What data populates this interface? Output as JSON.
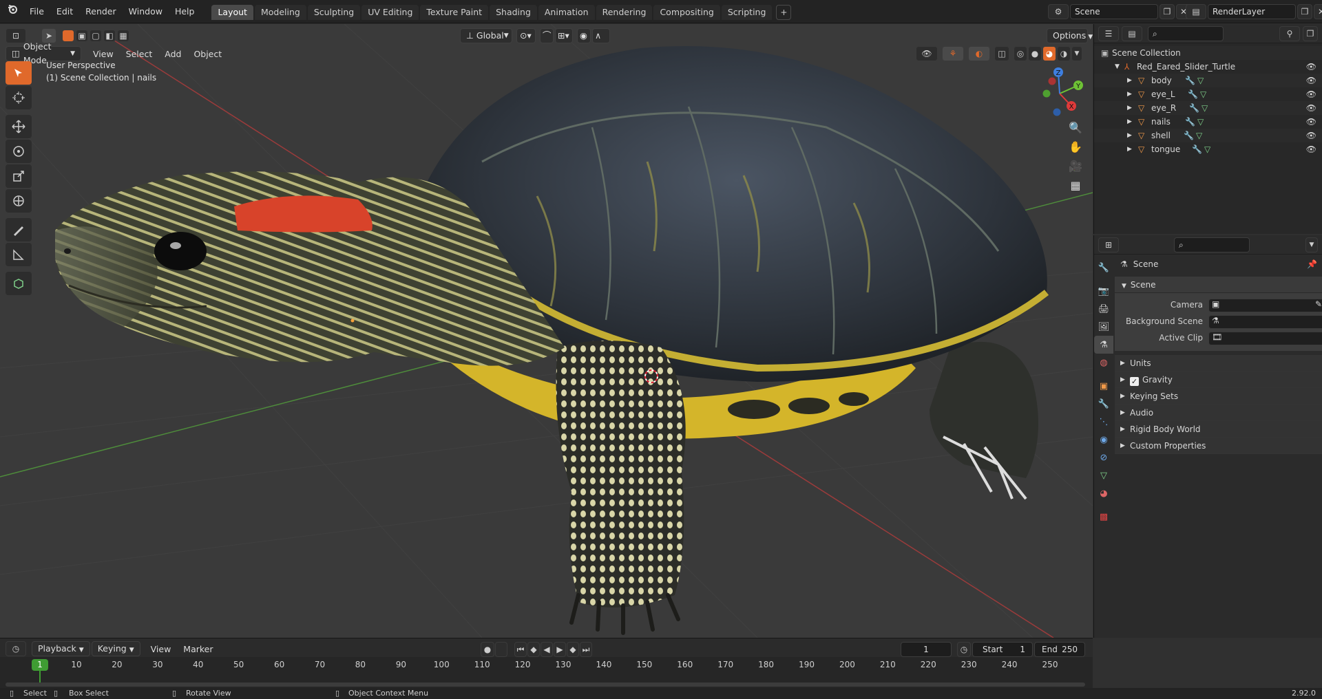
{
  "menubar": {
    "items": [
      "File",
      "Edit",
      "Render",
      "Window",
      "Help"
    ],
    "workspaces": [
      "Layout",
      "Modeling",
      "Sculpting",
      "UV Editing",
      "Texture Paint",
      "Shading",
      "Animation",
      "Rendering",
      "Compositing",
      "Scripting"
    ],
    "active_workspace": "Layout",
    "add_tab": "+",
    "scene_field": "Scene",
    "render_layer_field": "RenderLayer"
  },
  "viewport": {
    "mode": "Object Mode",
    "menus": [
      "View",
      "Select",
      "Add",
      "Object"
    ],
    "transform_orientation": "Global",
    "options_label": "Options",
    "perspective_label": "User Perspective",
    "collection_label": "(1) Scene Collection | nails",
    "gizmo_axes": {
      "x": "X",
      "y": "Y",
      "z": "Z"
    }
  },
  "outliner": {
    "root": "Scene Collection",
    "collection": "Red_Eared_Slider_Turtle",
    "objects": [
      "body",
      "eye_L",
      "eye_R",
      "nails",
      "shell",
      "tongue"
    ]
  },
  "properties": {
    "header": "Scene",
    "panel": "Scene",
    "fields": [
      {
        "label": "Camera"
      },
      {
        "label": "Background Scene"
      },
      {
        "label": "Active Clip"
      }
    ],
    "subpanels": [
      "Units",
      "Gravity",
      "Keying Sets",
      "Audio",
      "Rigid Body World",
      "Custom Properties"
    ]
  },
  "timeline": {
    "menus": [
      "Playback",
      "Keying",
      "View",
      "Marker"
    ],
    "current_frame": "1",
    "start_label": "Start",
    "start_value": "1",
    "end_label": "End",
    "end_value": "250",
    "ticks": [
      "1",
      "10",
      "20",
      "30",
      "40",
      "50",
      "60",
      "70",
      "80",
      "90",
      "100",
      "110",
      "120",
      "130",
      "140",
      "150",
      "160",
      "170",
      "180",
      "190",
      "200",
      "210",
      "220",
      "230",
      "240",
      "250"
    ]
  },
  "statusbar": {
    "select": "Select",
    "box_select": "Box Select",
    "rotate_view": "Rotate View",
    "context_menu": "Object Context Menu",
    "version": "2.92.0"
  },
  "colors": {
    "accent": "#e0692b",
    "selected_frame": "#3f9c33",
    "x_axis": "#e03a3a",
    "y_axis": "#6ec235",
    "z_axis": "#3e7fe0"
  }
}
